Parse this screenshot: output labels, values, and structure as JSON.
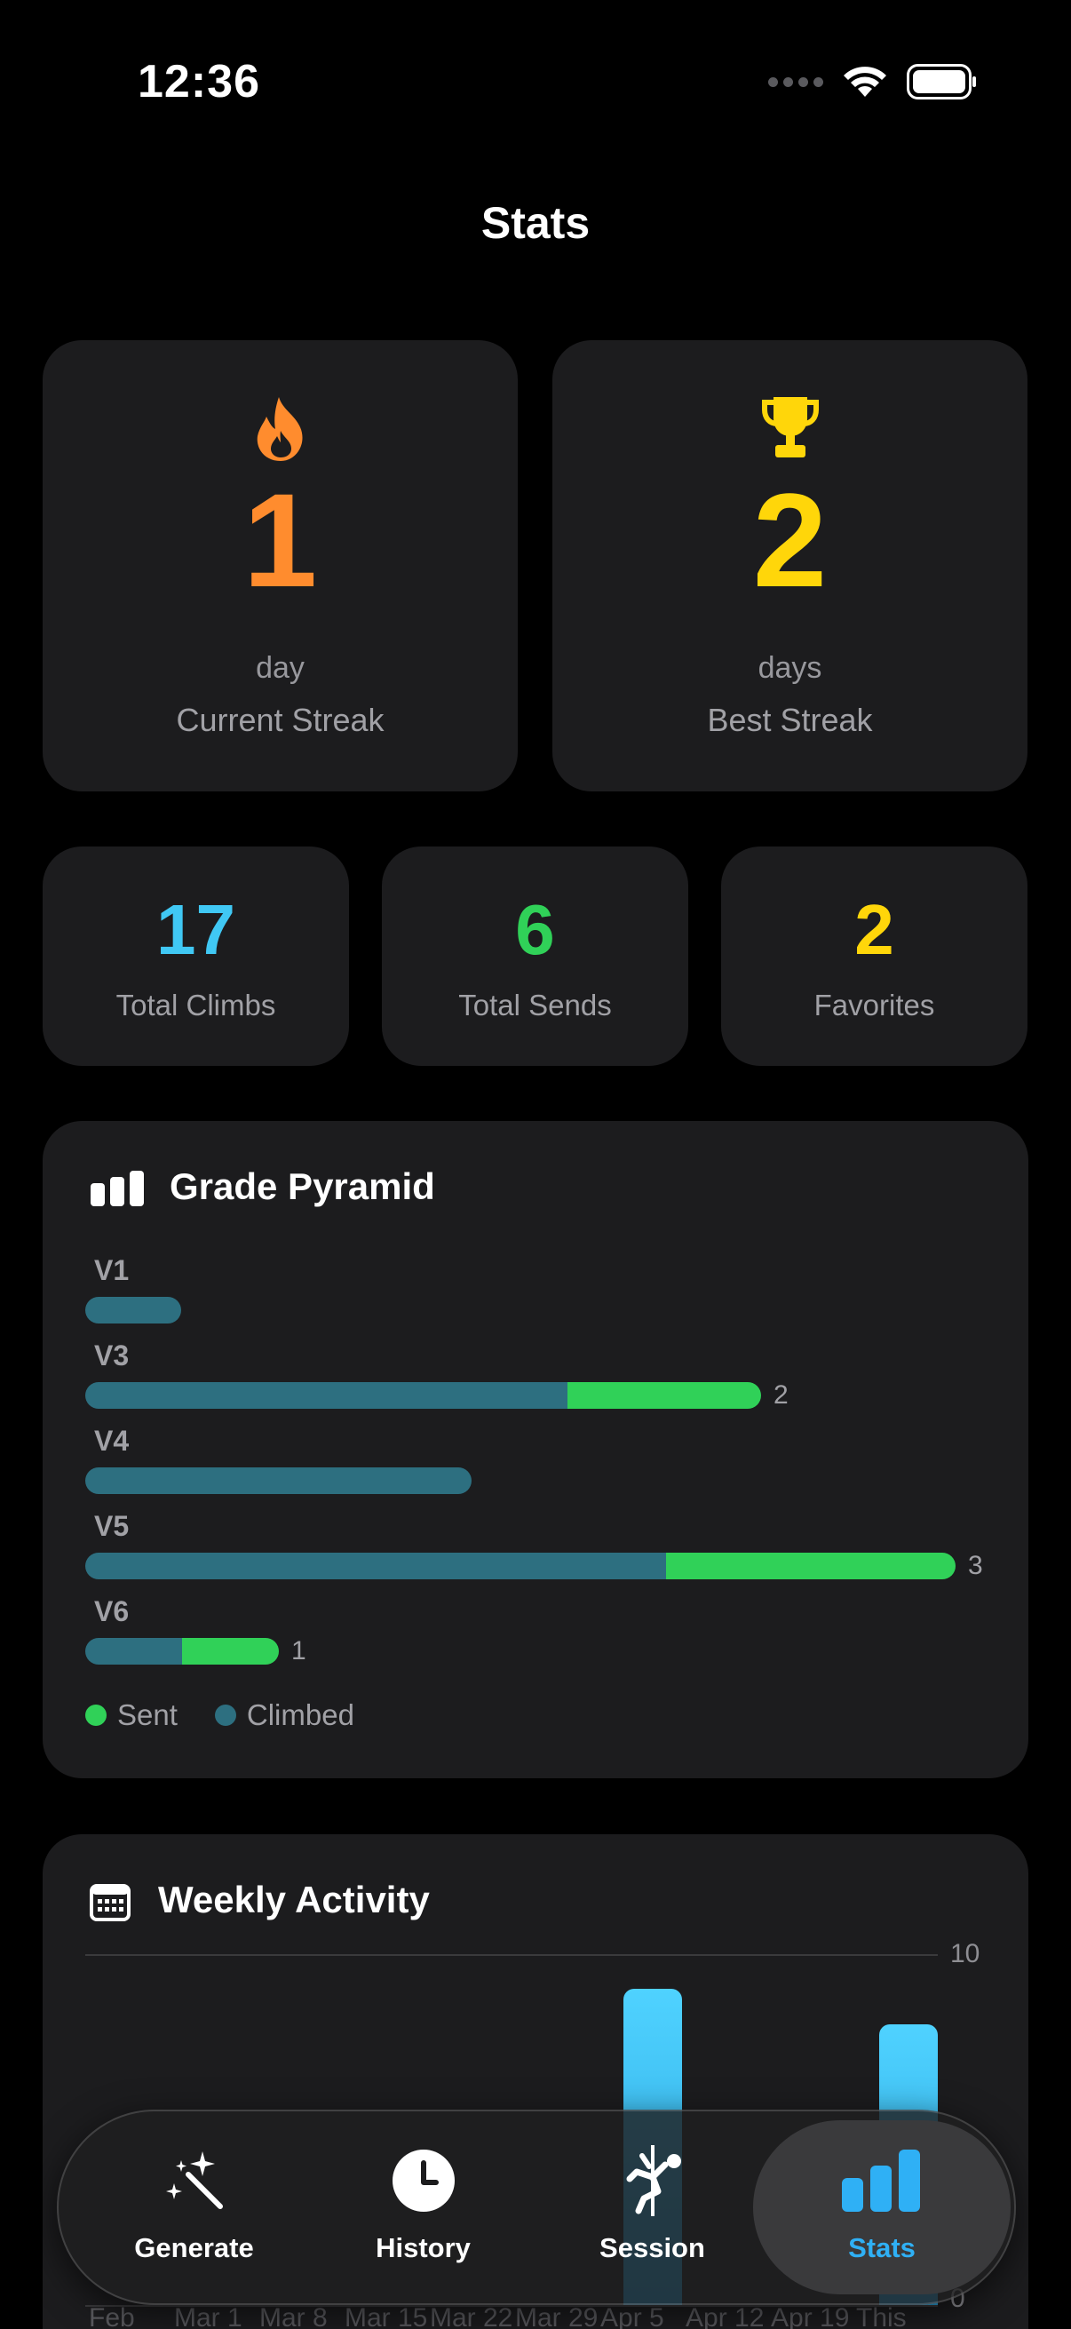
{
  "status_bar": {
    "time": "12:36"
  },
  "nav": {
    "title": "Stats"
  },
  "streaks": {
    "current": {
      "value": "1",
      "unit": "day",
      "label": "Current Streak",
      "color": "#ff8c2e"
    },
    "best": {
      "value": "2",
      "unit": "days",
      "label": "Best Streak",
      "color": "#ffd60a"
    }
  },
  "totals": {
    "climbs": {
      "value": "17",
      "label": "Total Climbs",
      "color": "#40c8f4"
    },
    "sends": {
      "value": "6",
      "label": "Total Sends",
      "color": "#30d158"
    },
    "favorites": {
      "value": "2",
      "label": "Favorites",
      "color": "#ffd60a"
    }
  },
  "grade_pyramid": {
    "title": "Grade Pyramid",
    "legend": {
      "sent": "Sent",
      "climbed": "Climbed"
    },
    "colors": {
      "sent": "#30d158",
      "climbed": "#2d6f80"
    },
    "rows": [
      {
        "grade": "V1",
        "climbed_fraction": 0.11,
        "sent_fraction": 0,
        "count_label": ""
      },
      {
        "grade": "V3",
        "climbed_fraction": 0.555,
        "sent_fraction": 0.222,
        "count_label": "2"
      },
      {
        "grade": "V4",
        "climbed_fraction": 0.444,
        "sent_fraction": 0,
        "count_label": ""
      },
      {
        "grade": "V5",
        "climbed_fraction": 0.667,
        "sent_fraction": 0.333,
        "count_label": "3"
      },
      {
        "grade": "V6",
        "climbed_fraction": 0.111,
        "sent_fraction": 0.111,
        "count_label": "1"
      }
    ]
  },
  "weekly_activity": {
    "title": "Weekly Activity",
    "chart_data": {
      "type": "bar",
      "y_max_label": "10",
      "y_min_label": "0",
      "ylim": [
        0,
        10
      ],
      "categories": [
        "Feb",
        "Mar 1",
        "Mar 8",
        "Mar 15",
        "Mar 22",
        "Mar 29",
        "Apr 5",
        "Apr 12",
        "Apr 19",
        "This"
      ],
      "values": [
        0,
        0,
        0,
        0,
        0,
        0,
        9,
        0,
        0,
        8
      ],
      "color": "#3ec6fa"
    }
  },
  "tab_bar": {
    "tabs": [
      {
        "label": "Generate",
        "icon": "magic-wand-icon"
      },
      {
        "label": "History",
        "icon": "clock-icon"
      },
      {
        "label": "Session",
        "icon": "climber-icon"
      },
      {
        "label": "Stats",
        "icon": "bar-chart-icon"
      }
    ],
    "active_color": "#2fb0f5"
  }
}
